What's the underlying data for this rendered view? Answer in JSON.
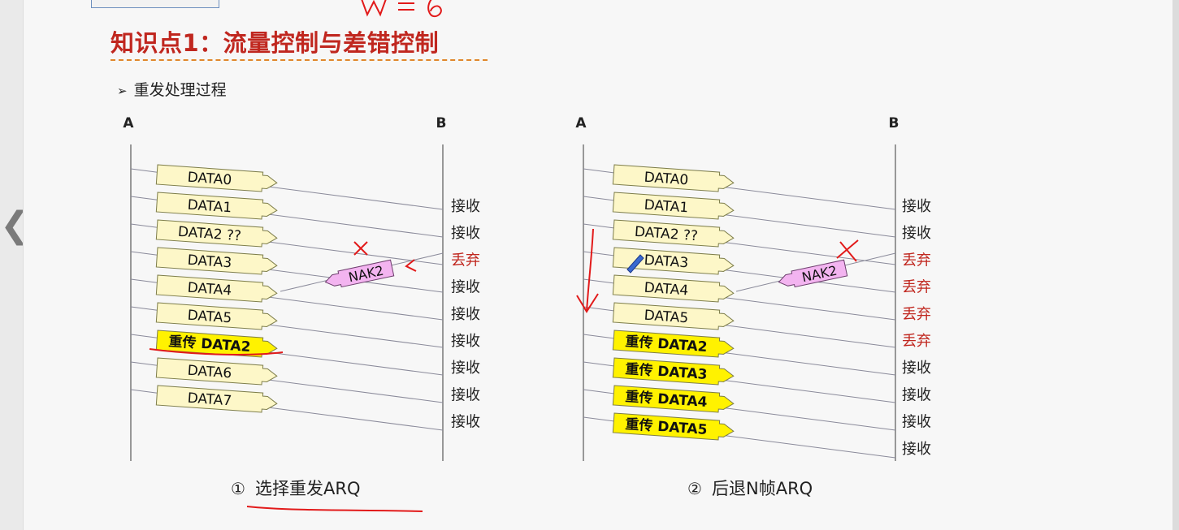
{
  "page": {
    "title": "知识点1：流量控制与差错控制",
    "bullet": "重发处理过程",
    "bullet_mark": "➢"
  },
  "diagrams": [
    {
      "id": "selective-repeat",
      "sender_label": "A",
      "receiver_label": "B",
      "frames": [
        {
          "label": "DATA0",
          "kind": "normal"
        },
        {
          "label": "DATA1",
          "kind": "normal"
        },
        {
          "label": "DATA2 ??",
          "kind": "normal"
        },
        {
          "label": "DATA3",
          "kind": "normal"
        },
        {
          "label": "DATA4",
          "kind": "normal"
        },
        {
          "label": "DATA5",
          "kind": "normal"
        },
        {
          "label": "重传 DATA2",
          "kind": "retransmit"
        },
        {
          "label": "DATA6",
          "kind": "normal"
        },
        {
          "label": "DATA7",
          "kind": "normal"
        }
      ],
      "nak_label": "NAK2",
      "receiver_actions": [
        {
          "label": "接收",
          "status": "accept"
        },
        {
          "label": "接收",
          "status": "accept"
        },
        {
          "label": "丢弃",
          "status": "discard"
        },
        {
          "label": "接收",
          "status": "accept"
        },
        {
          "label": "接收",
          "status": "accept"
        },
        {
          "label": "接收",
          "status": "accept"
        },
        {
          "label": "接收",
          "status": "accept"
        },
        {
          "label": "接收",
          "status": "accept"
        },
        {
          "label": "接收",
          "status": "accept"
        }
      ],
      "caption_num": "①",
      "caption": "选择重发ARQ"
    },
    {
      "id": "go-back-n",
      "sender_label": "A",
      "receiver_label": "B",
      "frames": [
        {
          "label": "DATA0",
          "kind": "normal"
        },
        {
          "label": "DATA1",
          "kind": "normal"
        },
        {
          "label": "DATA2 ??",
          "kind": "normal"
        },
        {
          "label": "DATA3",
          "kind": "normal"
        },
        {
          "label": "DATA4",
          "kind": "normal"
        },
        {
          "label": "DATA5",
          "kind": "normal"
        },
        {
          "label": "重传 DATA2",
          "kind": "retransmit"
        },
        {
          "label": "重传 DATA3",
          "kind": "retransmit"
        },
        {
          "label": "重传 DATA4",
          "kind": "retransmit"
        },
        {
          "label": "重传 DATA5",
          "kind": "retransmit"
        }
      ],
      "nak_label": "NAK2",
      "receiver_actions": [
        {
          "label": "接收",
          "status": "accept"
        },
        {
          "label": "接收",
          "status": "accept"
        },
        {
          "label": "丢弃",
          "status": "discard"
        },
        {
          "label": "丢弃",
          "status": "discard"
        },
        {
          "label": "丢弃",
          "status": "discard"
        },
        {
          "label": "丢弃",
          "status": "discard"
        },
        {
          "label": "接收",
          "status": "accept"
        },
        {
          "label": "接收",
          "status": "accept"
        },
        {
          "label": "接收",
          "status": "accept"
        },
        {
          "label": "接收",
          "status": "accept"
        }
      ],
      "caption_num": "②",
      "caption": "后退N帧ARQ"
    }
  ],
  "colors": {
    "title": "#c0271f",
    "frame_fill": "#fdf7c8",
    "retransmit_fill": "#fff200",
    "nak_fill": "#f3b4f0",
    "accept": "#222222",
    "discard": "#c0271f",
    "annotation": "#e21a1a"
  }
}
